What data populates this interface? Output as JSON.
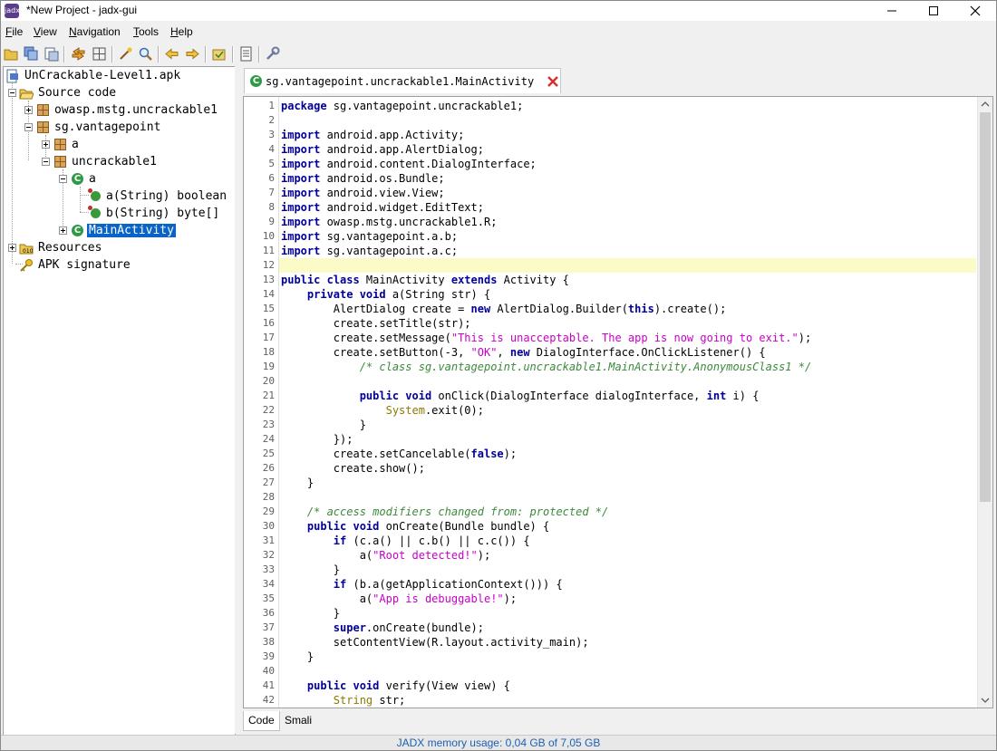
{
  "window": {
    "title": "*New Project - jadx-gui",
    "app_icon_label": "jadx"
  },
  "menu": [
    {
      "label": "File",
      "mnemonic": "F",
      "rest": "ile"
    },
    {
      "label": "View",
      "mnemonic": "V",
      "rest": "iew"
    },
    {
      "label": "Navigation",
      "mnemonic": "N",
      "rest": "avigation"
    },
    {
      "label": "Tools",
      "mnemonic": "T",
      "rest": "ools"
    },
    {
      "label": "Help",
      "mnemonic": "H",
      "rest": "elp"
    }
  ],
  "toolbar": [
    "open-file-icon",
    "save-all-icon",
    "export-icon",
    "sync-icon",
    "flatten-packages-icon",
    "decompile-all-icon",
    "search-icon",
    "back-icon",
    "forward-icon",
    "deobfuscation-icon",
    "log-icon",
    "preferences-icon"
  ],
  "tree": {
    "root": "UnCrackable-Level1.apk",
    "source_code": "Source code",
    "pkg_owasp": "owasp.mstg.uncrackable1",
    "pkg_sg": "sg.vantagepoint",
    "pkg_a": "a",
    "pkg_uncrackable1": "uncrackable1",
    "class_a": "a",
    "method_a": "a(String) boolean",
    "method_b": "b(String) byte[]",
    "class_main": "MainActivity",
    "resources": "Resources",
    "apk_signature": "APK signature"
  },
  "editor_tab": {
    "label": "sg.vantagepoint.uncrackable1.MainActivity"
  },
  "code": {
    "line_numbers": [
      "1",
      "2",
      "3",
      "4",
      "5",
      "6",
      "7",
      "8",
      "9",
      "10",
      "11",
      "12",
      "13",
      "14",
      "15",
      "16",
      "17",
      "18",
      "19",
      "20",
      "21",
      "22",
      "23",
      "24",
      "25",
      "26",
      "27",
      "28",
      "29",
      "30",
      "31",
      "32",
      "33",
      "34",
      "35",
      "36",
      "37",
      "38",
      "39",
      "40",
      "41",
      "42"
    ],
    "l1_kw": "package",
    "l1_rest": " sg.vantagepoint.uncrackable1;",
    "imp_kw": "import",
    "l3": " android.app.Activity;",
    "l4": " android.app.AlertDialog;",
    "l5": " android.content.DialogInterface;",
    "l6": " android.os.Bundle;",
    "l7": " android.view.View;",
    "l8": " android.widget.EditText;",
    "l9": " owasp.mstg.uncrackable1.R;",
    "l10": " sg.vantagepoint.a.b;",
    "l11": " sg.vantagepoint.a.c;",
    "l13_kw1": "public class",
    "l13_mid": " MainActivity ",
    "l13_kw2": "extends",
    "l13_rest": " Activity {",
    "l14_ind": "    ",
    "l14_kw": "private void",
    "l14_rest": " a(String str) {",
    "l15_pre": "        AlertDialog create = ",
    "l15_kw": "new",
    "l15_mid": " AlertDialog.Builder(",
    "l15_kw2": "this",
    "l15_rest": ").create();",
    "l16": "        create.setTitle(str);",
    "l17_pre": "        create.setMessage(",
    "l17_str": "\"This is unacceptable. The app is now going to exit.\"",
    "l17_rest": ");",
    "l18_pre": "        create.setButton(-3, ",
    "l18_str": "\"OK\"",
    "l18_mid": ", ",
    "l18_kw": "new",
    "l18_rest": " DialogInterface.OnClickListener() {",
    "l19_ind": "            ",
    "l19_cmt": "/* class sg.vantagepoint.uncrackable1.MainActivity.AnonymousClass1 */",
    "l21_ind": "            ",
    "l21_kw": "public void",
    "l21_mid": " onClick(DialogInterface dialogInterface, ",
    "l21_kw2": "int",
    "l21_rest": " i) {",
    "l22_ind": "                ",
    "l22_sys": "System",
    "l22_rest": ".exit(0);",
    "l23": "            }",
    "l24": "        });",
    "l25_pre": "        create.setCancelable(",
    "l25_kw": "false",
    "l25_rest": ");",
    "l26": "        create.show();",
    "l27": "    }",
    "l29_ind": "    ",
    "l29_cmt": "/* access modifiers changed from: protected */",
    "l30_ind": "    ",
    "l30_kw": "public void",
    "l30_rest": " onCreate(Bundle bundle) {",
    "l31_ind": "        ",
    "l31_kw": "if",
    "l31_rest": " (c.a() || c.b() || c.c()) {",
    "l32_pre": "            a(",
    "l32_str": "\"Root detected!\"",
    "l32_rest": ");",
    "l33": "        }",
    "l34_ind": "        ",
    "l34_kw": "if",
    "l34_rest": " (b.a(getApplicationContext())) {",
    "l35_pre": "            a(",
    "l35_str": "\"App is debuggable!\"",
    "l35_rest": ");",
    "l36": "        }",
    "l37_ind": "        ",
    "l37_kw": "super",
    "l37_rest": ".onCreate(bundle);",
    "l38": "        setContentView(R.layout.activity_main);",
    "l39": "    }",
    "l41_ind": "    ",
    "l41_kw": "public void",
    "l41_rest": " verify(View view) {",
    "l42_ind": "        ",
    "l42_sys": "String",
    "l42_rest": " str;"
  },
  "bottom_tabs": {
    "code": "Code",
    "smali": "Smali"
  },
  "status": {
    "memory": "JADX memory usage: 0,04 GB of 7,05 GB"
  }
}
